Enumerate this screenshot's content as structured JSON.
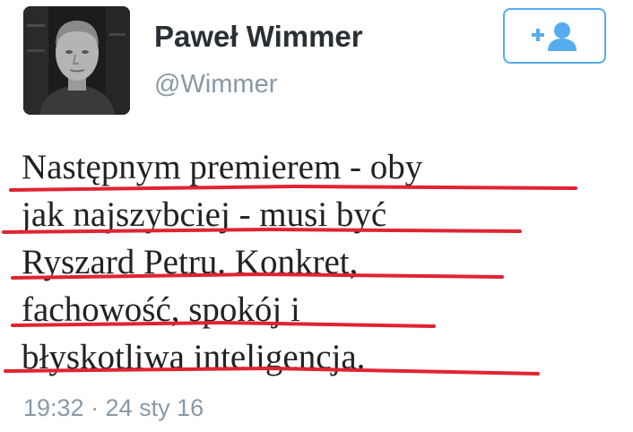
{
  "user": {
    "display_name": "Paweł Wimmer",
    "handle": "@Wimmer"
  },
  "icons": {
    "avatar": "profile-photo",
    "follow": "add-user-icon"
  },
  "tweet": {
    "lines": [
      "Następnym premierem - oby",
      "jak najszybciej - musi być",
      "Ryszard Petru. Konkret,",
      "fachowość, spokój i",
      "błyskotliwa inteligencja."
    ],
    "timestamp": "19:32 · 24 sty 16"
  },
  "colors": {
    "accent": "#55acee",
    "underline": "#e02431",
    "meta_text": "#8899a6",
    "name_text": "#292f33"
  }
}
